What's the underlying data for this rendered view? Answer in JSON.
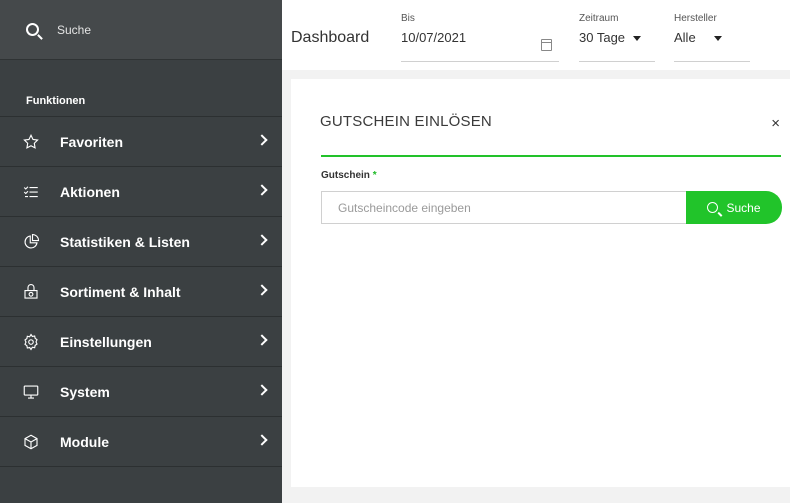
{
  "sidebar": {
    "search_label": "Suche",
    "section_title": "Funktionen",
    "items": [
      {
        "label": "Favoriten",
        "icon": "star-icon"
      },
      {
        "label": "Aktionen",
        "icon": "list-icon"
      },
      {
        "label": "Statistiken & Listen",
        "icon": "pie-chart-icon"
      },
      {
        "label": "Sortiment & Inhalt",
        "icon": "basket-icon"
      },
      {
        "label": "Einstellungen",
        "icon": "gear-icon"
      },
      {
        "label": "System",
        "icon": "monitor-icon"
      },
      {
        "label": "Module",
        "icon": "cube-icon"
      }
    ]
  },
  "topbar": {
    "title": "Dashboard",
    "bis": {
      "label": "Bis",
      "value": "10/07/2021"
    },
    "zeitraum": {
      "label": "Zeitraum",
      "value": "30 Tage"
    },
    "hersteller": {
      "label": "Hersteller",
      "value": "Alle"
    }
  },
  "voucher": {
    "title": "GUTSCHEIN EINLÖSEN",
    "close": "×",
    "field_label": "Gutschein",
    "required_mark": "*",
    "placeholder": "Gutscheincode eingeben",
    "button_label": "Suche"
  },
  "colors": {
    "sidebar_bg": "#3b4042",
    "accent_green": "#21c42a"
  }
}
